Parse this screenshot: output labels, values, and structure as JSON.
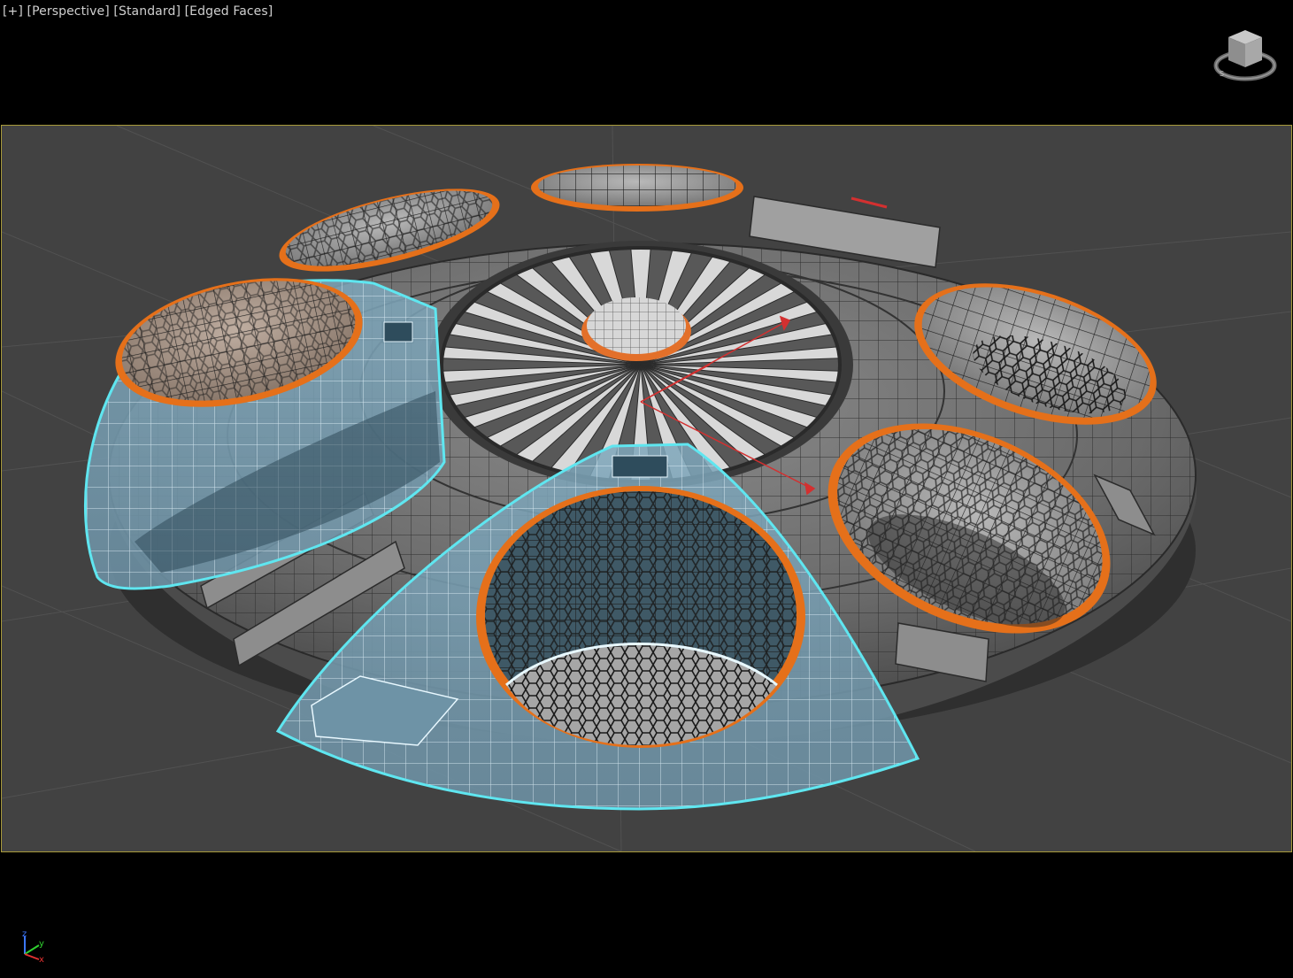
{
  "viewport": {
    "menu_plus": "[+]",
    "view_mode": "[Perspective]",
    "shading": "[Standard]",
    "display_mode": "[Edged Faces]"
  },
  "axis_tripod": {
    "z": "z",
    "y": "y",
    "x": "x"
  },
  "colors": {
    "background": "#000000",
    "viewport_bg": "#424242",
    "safe_frame": "#a89a3a",
    "mesh_gray": "#646464",
    "selection_edge": "#5fe6f0",
    "dome_rim": "#e5701a",
    "gizmo_red": "#d33030"
  },
  "icons": [
    "viewcube-icon",
    "axis-tripod-icon",
    "transform-gizmo-icon"
  ]
}
